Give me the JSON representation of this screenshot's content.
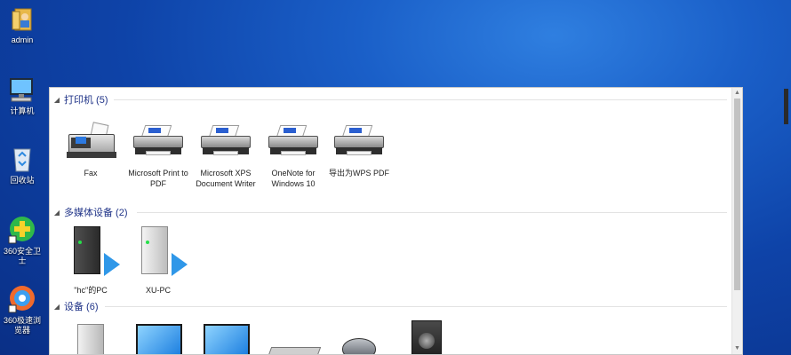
{
  "desktop": {
    "icons": [
      {
        "label": "admin",
        "icon": "user-folder-icon"
      },
      {
        "label": "计算机",
        "icon": "computer-icon"
      },
      {
        "label": "回收站",
        "icon": "recycle-bin-icon"
      },
      {
        "label": "360安全卫士",
        "icon": "360-security-icon"
      },
      {
        "label": "360极速浏览器",
        "icon": "360-browser-icon"
      }
    ]
  },
  "explorer": {
    "groups": {
      "printers": {
        "title": "打印机 (5)",
        "items": [
          {
            "label": "Fax",
            "icon": "fax-icon"
          },
          {
            "label": "Microsoft Print to PDF",
            "icon": "printer-icon"
          },
          {
            "label": "Microsoft XPS Document Writer",
            "icon": "printer-icon"
          },
          {
            "label": "OneNote for Windows 10",
            "icon": "printer-icon"
          },
          {
            "label": "导出为WPS PDF",
            "icon": "printer-icon"
          }
        ]
      },
      "multimedia": {
        "title": "多媒体设备 (2)",
        "items": [
          {
            "label": "\"hc\"的PC",
            "icon": "media-pc-icon"
          },
          {
            "label": "XU-PC",
            "icon": "media-pc-icon"
          }
        ]
      },
      "devices": {
        "title": "设备 (6)",
        "items": [
          {
            "icon": "computer-tower-icon"
          },
          {
            "icon": "monitor-icon"
          },
          {
            "icon": "monitor-icon"
          },
          {
            "icon": "keyboard-icon"
          },
          {
            "icon": "mouse-icon"
          },
          {
            "icon": "speaker-icon"
          }
        ]
      }
    }
  },
  "colors": {
    "desktop_blue": "#1a5fc8",
    "group_header_text": "#1e3287",
    "media_arrow": "#2f97e8"
  }
}
